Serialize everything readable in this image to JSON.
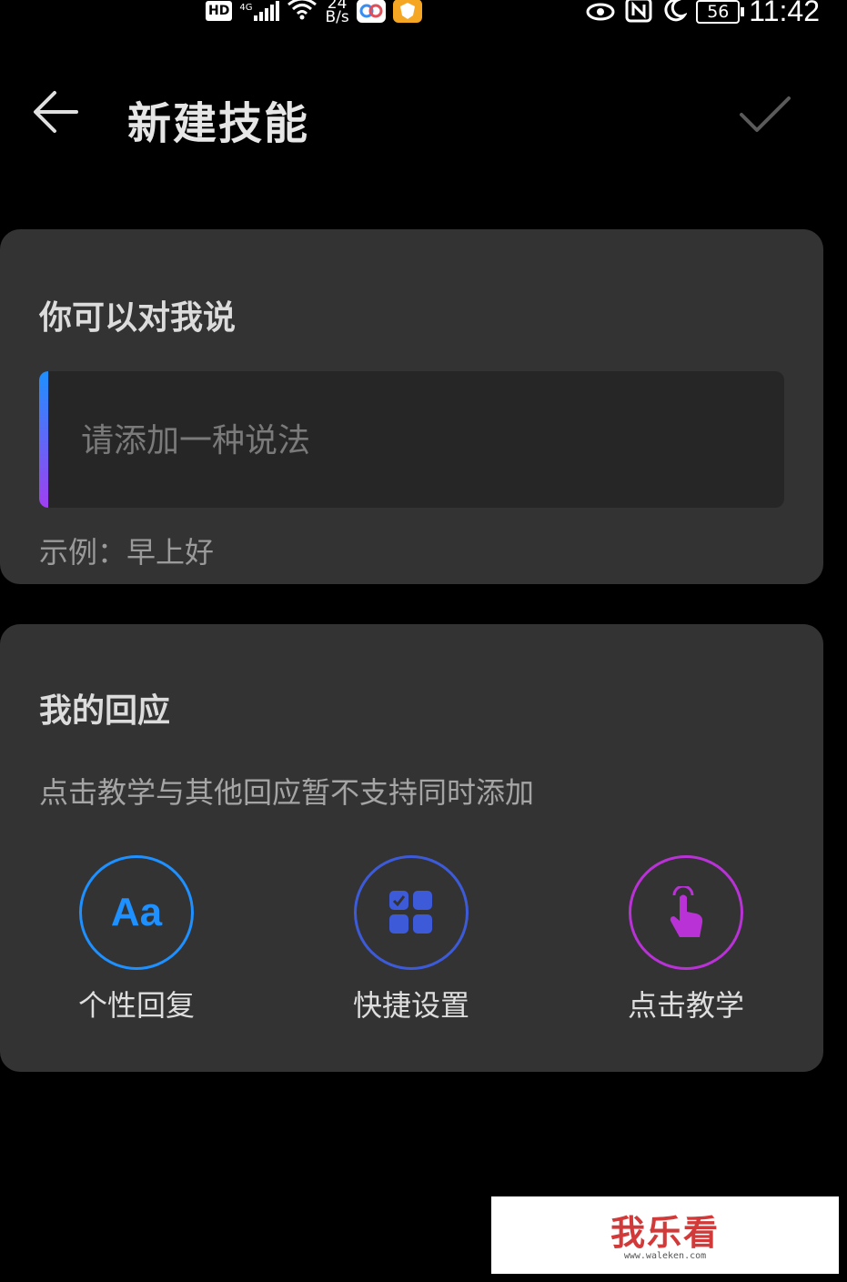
{
  "status_bar": {
    "hd": "HD",
    "net_badge": "4G",
    "net_speed_value": "24",
    "net_speed_unit": "B/s",
    "battery": "56",
    "time": "11:42"
  },
  "header": {
    "title": "新建技能"
  },
  "say_card": {
    "title": "你可以对我说",
    "input_placeholder": "请添加一种说法",
    "input_value": "",
    "example": "示例：早上好"
  },
  "response_card": {
    "title": "我的回应",
    "hint": "点击教学与其他回应暂不支持同时添加",
    "options": [
      {
        "label": "个性回复",
        "icon": "font-aa-icon",
        "icon_text": "Aa",
        "color": "#1e90ff"
      },
      {
        "label": "快捷设置",
        "icon": "grid-check-icon",
        "color": "#3d5bd9"
      },
      {
        "label": "点击教学",
        "icon": "tap-hand-icon",
        "color": "#b832d6"
      }
    ]
  },
  "watermark": {
    "main": "我乐看",
    "sub": "www.waleken.com"
  }
}
